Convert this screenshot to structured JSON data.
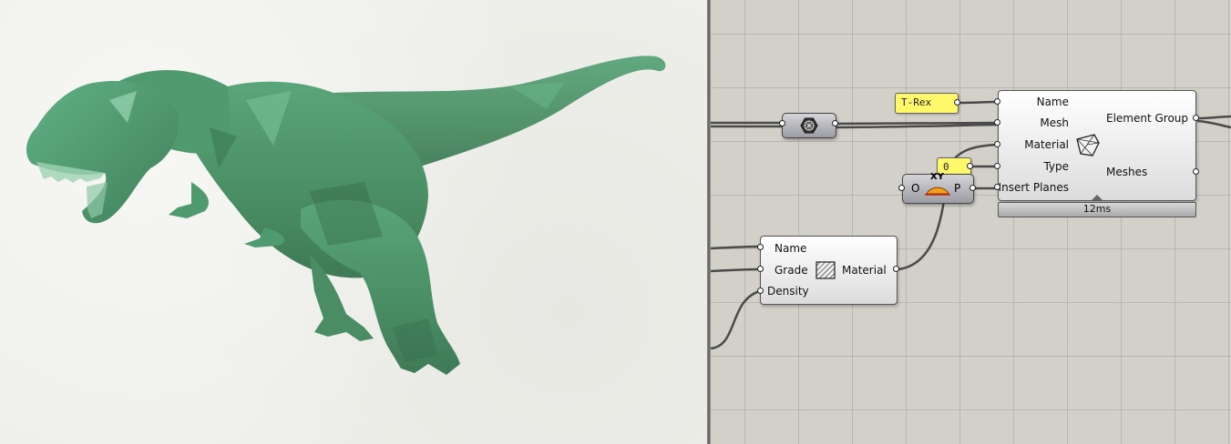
{
  "viewport": {
    "model": "t-rex-low-poly-mesh",
    "mesh_color": "#4f9a6e"
  },
  "canvas": {
    "main_component": {
      "inputs": [
        "Name",
        "Mesh",
        "Material",
        "Type",
        "Insert Planes"
      ],
      "outputs": [
        "Element Group",
        "Meshes"
      ],
      "icon": "mesh-group-icon",
      "timer": "12ms"
    },
    "name_panel": {
      "value": "T-Rex"
    },
    "type_panel": {
      "value": "0"
    },
    "plane_component": {
      "input": "O",
      "output": "P",
      "icon_label": "XY",
      "icon": "xy-plane-icon"
    },
    "mesh_param": {
      "icon": "mesh-param-icon"
    },
    "material_component": {
      "inputs": [
        "Name",
        "Grade",
        "Density"
      ],
      "outputs": [
        "Material"
      ],
      "icon": "hatch-material-icon"
    },
    "panel_color": "#fff86b"
  }
}
